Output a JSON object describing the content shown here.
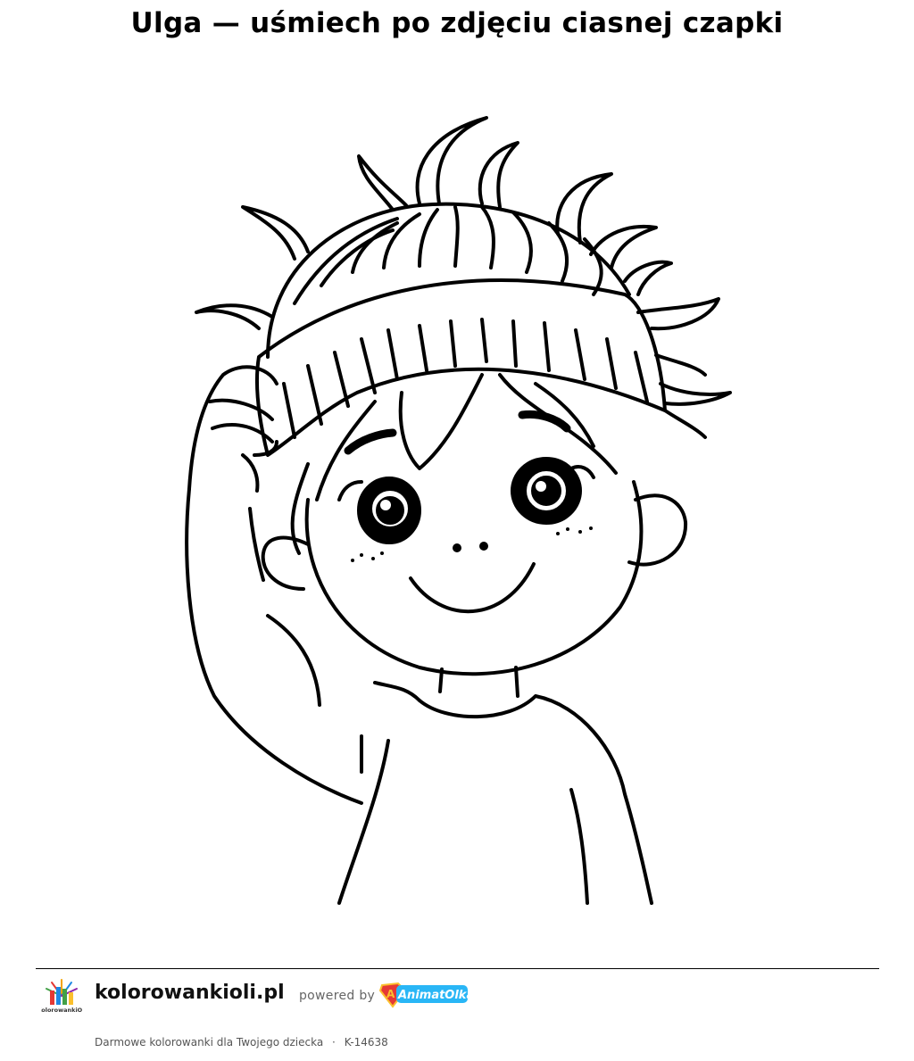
{
  "page": {
    "title": "Ulga — uśmiech po zdjęciu ciasnej czapki"
  },
  "illustration": {
    "subject": "coloring page line art"
  },
  "footer": {
    "logo_icon": "kolorowanki-oli-logo-icon",
    "logo_text": "KolorowankiOli",
    "site_name": "kolorowankioli.pl",
    "powered_by": "powered by",
    "partner_logo_text": "AnimatOlka",
    "tagline": "Darmowe kolorowanki dla Twojego dziecka",
    "separator": "·",
    "code": "K-14638"
  }
}
